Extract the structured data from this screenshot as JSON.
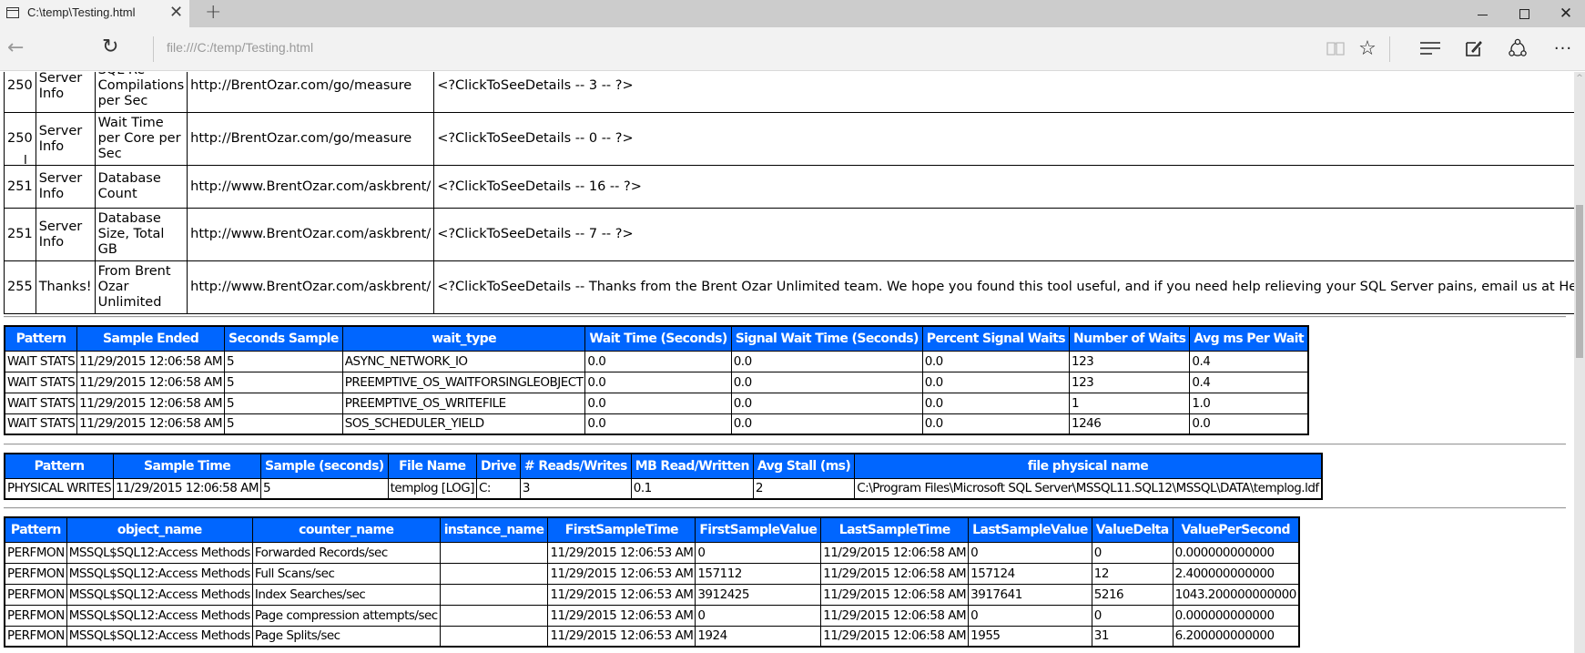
{
  "browser": {
    "tab_title": "C:\\temp\\Testing.html",
    "tab_close_icon": "✕",
    "new_tab_icon": "+",
    "url": "file:///C:/temp/Testing.html",
    "icons": {
      "back": "←",
      "refresh": "↻",
      "reading_view": "📖",
      "favorite": "☆",
      "hub": "≡",
      "web_note": "✎",
      "share": "⟁",
      "more": "···",
      "minimize": "",
      "maximize": "",
      "close": "✕"
    }
  },
  "checks_table": {
    "rows": [
      {
        "priority": "250",
        "group": "Server Info",
        "finding": "SQL Re-Compilations per Sec",
        "url": "http://BrentOzar.com/go/measure",
        "details": "<?ClickToSeeDetails -- 3 -- ?>"
      },
      {
        "priority": "250",
        "group": "Server Info",
        "finding": "Wait Time per Core per Sec",
        "url": "http://BrentOzar.com/go/measure",
        "details": "<?ClickToSeeDetails -- 0 -- ?>"
      },
      {
        "priority": "251",
        "group": "Server Info",
        "finding": "Database Count",
        "url": "http://www.BrentOzar.com/askbrent/",
        "details": "<?ClickToSeeDetails -- 16 -- ?>"
      },
      {
        "priority": "251",
        "group": "Server Info",
        "finding": "Database Size, Total GB",
        "url": "http://www.BrentOzar.com/askbrent/",
        "details": "<?ClickToSeeDetails -- 7 -- ?>"
      },
      {
        "priority": "255",
        "group": "Thanks!",
        "finding": "From Brent Ozar Unlimited",
        "url": "http://www.BrentOzar.com/askbrent/",
        "details": "<?ClickToSeeDetails -- Thanks from the Brent Ozar Unlimited team. We hope you found this tool useful, and if you need help relieving your SQL Server pains, email us at Help@BrentOza"
      }
    ]
  },
  "wait_stats_table": {
    "headers": [
      "Pattern",
      "Sample Ended",
      "Seconds Sample",
      "wait_type",
      "Wait Time (Seconds)",
      "Signal Wait Time (Seconds)",
      "Percent Signal Waits",
      "Number of Waits",
      "Avg ms Per Wait"
    ],
    "rows": [
      [
        "WAIT STATS",
        "11/29/2015 12:06:58 AM",
        "5",
        "ASYNC_NETWORK_IO",
        "0.0",
        "0.0",
        "0.0",
        "123",
        "0.4"
      ],
      [
        "WAIT STATS",
        "11/29/2015 12:06:58 AM",
        "5",
        "PREEMPTIVE_OS_WAITFORSINGLEOBJECT",
        "0.0",
        "0.0",
        "0.0",
        "123",
        "0.4"
      ],
      [
        "WAIT STATS",
        "11/29/2015 12:06:58 AM",
        "5",
        "PREEMPTIVE_OS_WRITEFILE",
        "0.0",
        "0.0",
        "0.0",
        "1",
        "1.0"
      ],
      [
        "WAIT STATS",
        "11/29/2015 12:06:58 AM",
        "5",
        "SOS_SCHEDULER_YIELD",
        "0.0",
        "0.0",
        "0.0",
        "1246",
        "0.0"
      ]
    ]
  },
  "file_stats_table": {
    "headers": [
      "Pattern",
      "Sample Time",
      "Sample (seconds)",
      "File Name",
      "Drive",
      "# Reads/Writes",
      "MB Read/Written",
      "Avg Stall (ms)",
      "file physical name"
    ],
    "rows": [
      [
        "PHYSICAL WRITES",
        "11/29/2015 12:06:58 AM",
        "5",
        "templog [LOG]",
        "C:",
        "3",
        "0.1",
        "2",
        "C:\\Program Files\\Microsoft SQL Server\\MSSQL11.SQL12\\MSSQL\\DATA\\templog.ldf"
      ]
    ]
  },
  "perfmon_table": {
    "headers": [
      "Pattern",
      "object_name",
      "counter_name",
      "instance_name",
      "FirstSampleTime",
      "FirstSampleValue",
      "LastSampleTime",
      "LastSampleValue",
      "ValueDelta",
      "ValuePerSecond"
    ],
    "rows": [
      [
        "PERFMON",
        "MSSQL$SQL12:Access Methods",
        "Forwarded Records/sec",
        "",
        "11/29/2015 12:06:53 AM",
        "0",
        "11/29/2015 12:06:58 AM",
        "0",
        "0",
        "0.000000000000"
      ],
      [
        "PERFMON",
        "MSSQL$SQL12:Access Methods",
        "Full Scans/sec",
        "",
        "11/29/2015 12:06:53 AM",
        "157112",
        "11/29/2015 12:06:58 AM",
        "157124",
        "12",
        "2.400000000000"
      ],
      [
        "PERFMON",
        "MSSQL$SQL12:Access Methods",
        "Index Searches/sec",
        "",
        "11/29/2015 12:06:53 AM",
        "3912425",
        "11/29/2015 12:06:58 AM",
        "3917641",
        "5216",
        "1043.200000000000"
      ],
      [
        "PERFMON",
        "MSSQL$SQL12:Access Methods",
        "Page compression attempts/sec",
        "",
        "11/29/2015 12:06:53 AM",
        "0",
        "11/29/2015 12:06:58 AM",
        "0",
        "0",
        "0.000000000000"
      ],
      [
        "PERFMON",
        "MSSQL$SQL12:Access Methods",
        "Page Splits/sec",
        "",
        "11/29/2015 12:06:53 AM",
        "1924",
        "11/29/2015 12:06:58 AM",
        "1955",
        "31",
        "6.200000000000"
      ]
    ]
  },
  "colors": {
    "header_blue": "#0066ff",
    "tab_strip": "#cccccc",
    "toolbar": "#f2f2f2"
  }
}
